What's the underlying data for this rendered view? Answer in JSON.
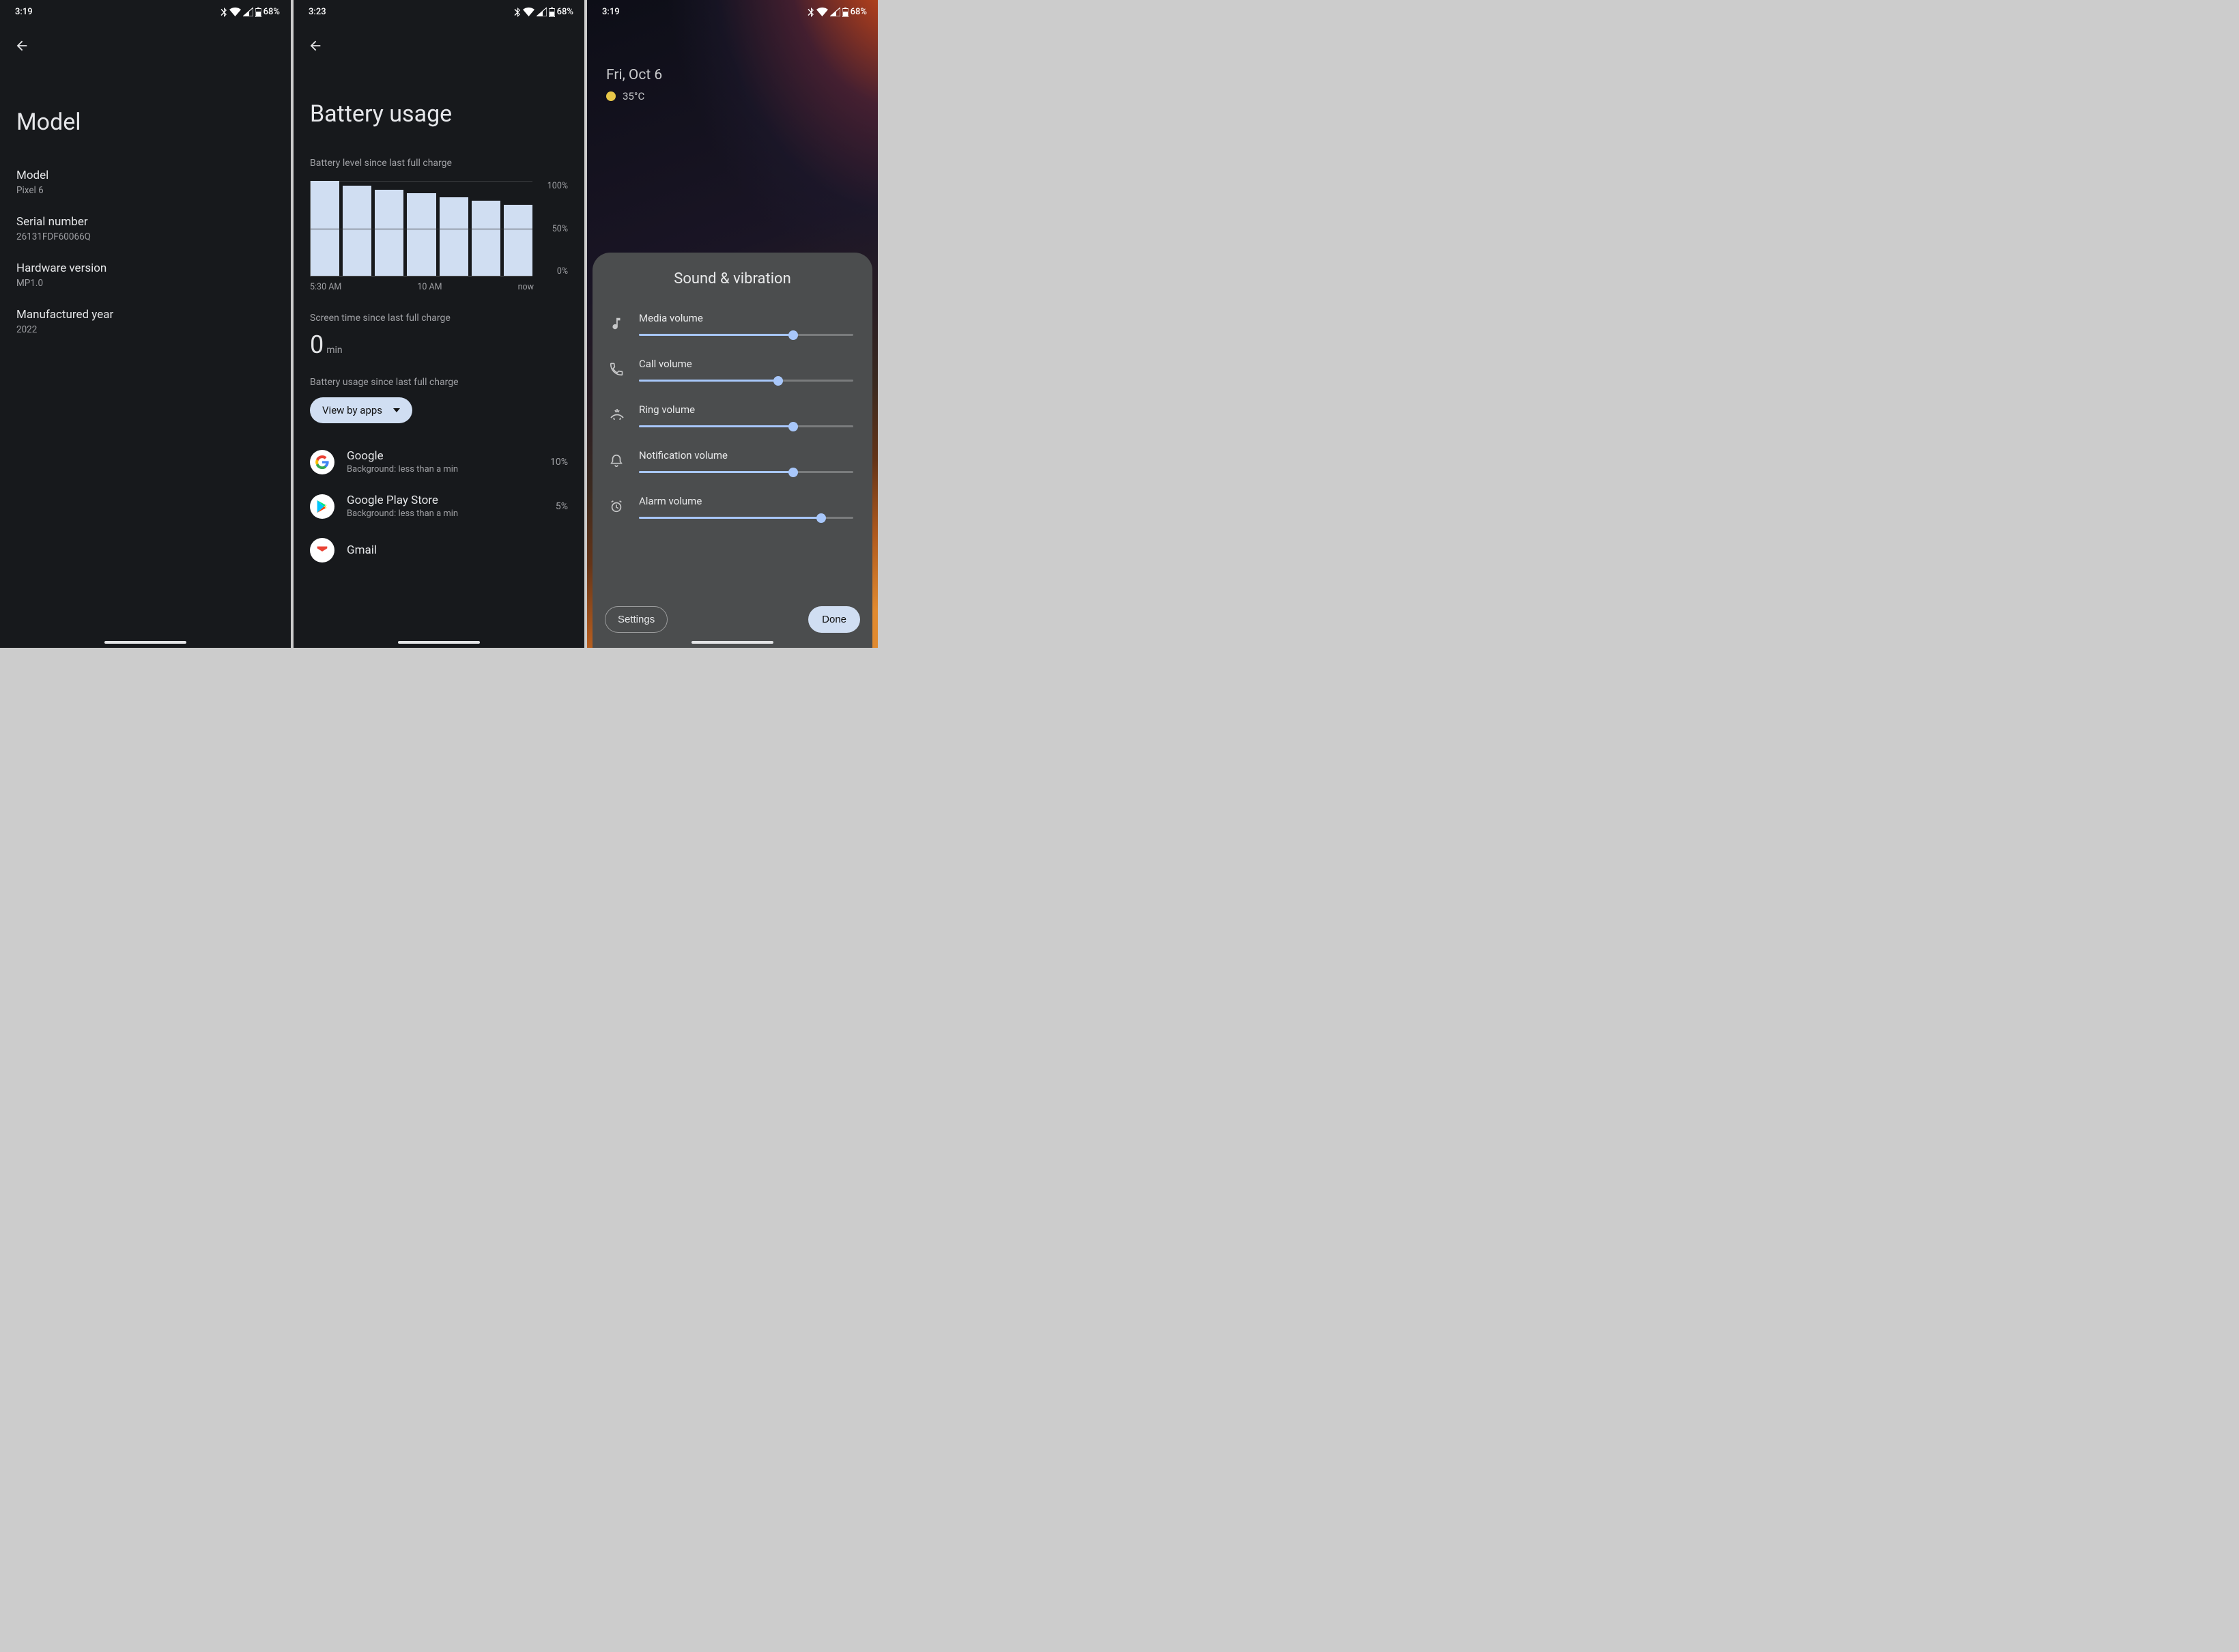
{
  "screen1": {
    "status": {
      "time": "3:19",
      "battery": "68%"
    },
    "title": "Model",
    "items": [
      {
        "label": "Model",
        "value": "Pixel 6"
      },
      {
        "label": "Serial number",
        "value": "26131FDF60066Q"
      },
      {
        "label": "Hardware version",
        "value": "MP1.0"
      },
      {
        "label": "Manufactured year",
        "value": "2022"
      }
    ]
  },
  "screen2": {
    "status": {
      "time": "3:23",
      "battery": "68%"
    },
    "title": "Battery usage",
    "chart_label": "Battery level since last full charge",
    "chart_data": {
      "type": "bar",
      "categories": [
        "5:30 AM",
        "",
        "",
        "10 AM",
        "",
        "",
        "now"
      ],
      "values": [
        100,
        95,
        91,
        87,
        83,
        79,
        75
      ],
      "yticks": [
        "100%",
        "50%",
        "0%"
      ],
      "ylim": [
        0,
        100
      ],
      "xticks_shown": [
        "5:30 AM",
        "10 AM",
        "now"
      ]
    },
    "screen_time_label": "Screen time since last full charge",
    "screen_time_value": "0",
    "screen_time_unit": "min",
    "usage_label": "Battery usage since last full charge",
    "chip_label": "View by apps",
    "apps": [
      {
        "name": "Google",
        "sub": "Background: less than a min",
        "pct": "10%",
        "icon": "google"
      },
      {
        "name": "Google Play Store",
        "sub": "Background: less than a min",
        "pct": "5%",
        "icon": "play"
      },
      {
        "name": "Gmail",
        "sub": "",
        "pct": "",
        "icon": "gmail"
      }
    ]
  },
  "screen3": {
    "status": {
      "time": "3:19",
      "battery": "68%"
    },
    "date": "Fri, Oct 6",
    "temp": "35°C",
    "sheet_title": "Sound & vibration",
    "sliders": [
      {
        "label": "Media volume",
        "value": 72,
        "icon": "music"
      },
      {
        "label": "Call volume",
        "value": 65,
        "icon": "phone"
      },
      {
        "label": "Ring volume",
        "value": 72,
        "icon": "ring"
      },
      {
        "label": "Notification volume",
        "value": 72,
        "icon": "bell"
      },
      {
        "label": "Alarm volume",
        "value": 85,
        "icon": "alarm"
      }
    ],
    "settings_btn": "Settings",
    "done_btn": "Done"
  }
}
